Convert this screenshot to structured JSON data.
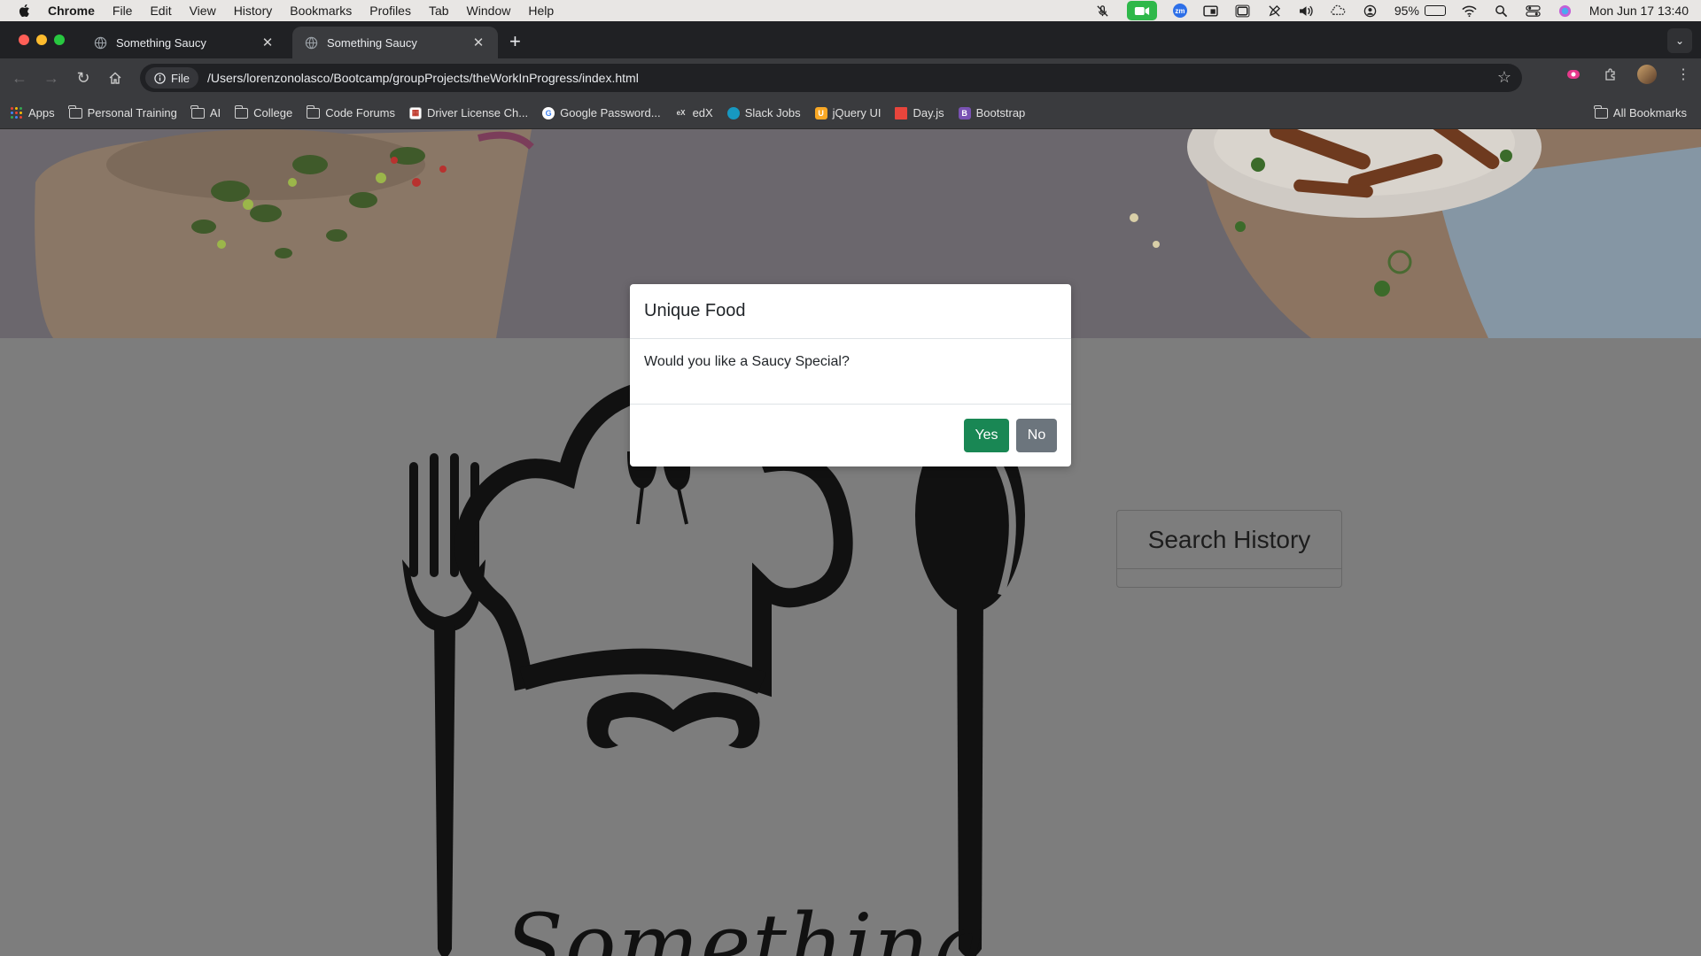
{
  "menubar": {
    "app_name": "Chrome",
    "items": [
      "File",
      "Edit",
      "View",
      "History",
      "Bookmarks",
      "Profiles",
      "Tab",
      "Window",
      "Help"
    ],
    "battery_percent": "95%",
    "battery_level": 0.95,
    "clock": "Mon Jun 17  13:40",
    "zoom_label": "zm"
  },
  "tabs": [
    {
      "title": "Something Saucy",
      "active": false
    },
    {
      "title": "Something Saucy",
      "active": true
    }
  ],
  "toolbar": {
    "chip_label": "File",
    "url": "/Users/lorenzonolasco/Bootcamp/groupProjects/theWorkInProgress/index.html"
  },
  "bookmarks": {
    "items": [
      {
        "label": "Apps",
        "icon": "apps-grid-icon"
      },
      {
        "label": "Personal Training",
        "icon": "folder-icon"
      },
      {
        "label": "AI",
        "icon": "folder-icon"
      },
      {
        "label": "College",
        "icon": "folder-icon"
      },
      {
        "label": "Code Forums",
        "icon": "folder-icon"
      },
      {
        "label": "Driver License Ch...",
        "icon": "dmv-icon"
      },
      {
        "label": "Google Password...",
        "icon": "google-icon"
      },
      {
        "label": "edX",
        "icon": "edx-icon"
      },
      {
        "label": "Slack Jobs",
        "icon": "salesforce-icon"
      },
      {
        "label": "jQuery UI",
        "icon": "jquery-icon"
      },
      {
        "label": "Day.js",
        "icon": "dayjs-icon"
      },
      {
        "label": "Bootstrap",
        "icon": "bootstrap-icon"
      }
    ],
    "all_bookmarks": "All Bookmarks"
  },
  "page": {
    "search_history_title": "Search History",
    "logo_text": "Something"
  },
  "modal": {
    "title": "Unique Food",
    "body": "Would you like a Saucy Special?",
    "yes_label": "Yes",
    "no_label": "No"
  },
  "colors": {
    "yes_button": "#198754",
    "no_button": "#6c757d",
    "overlay_page": "#7d7d7d"
  }
}
